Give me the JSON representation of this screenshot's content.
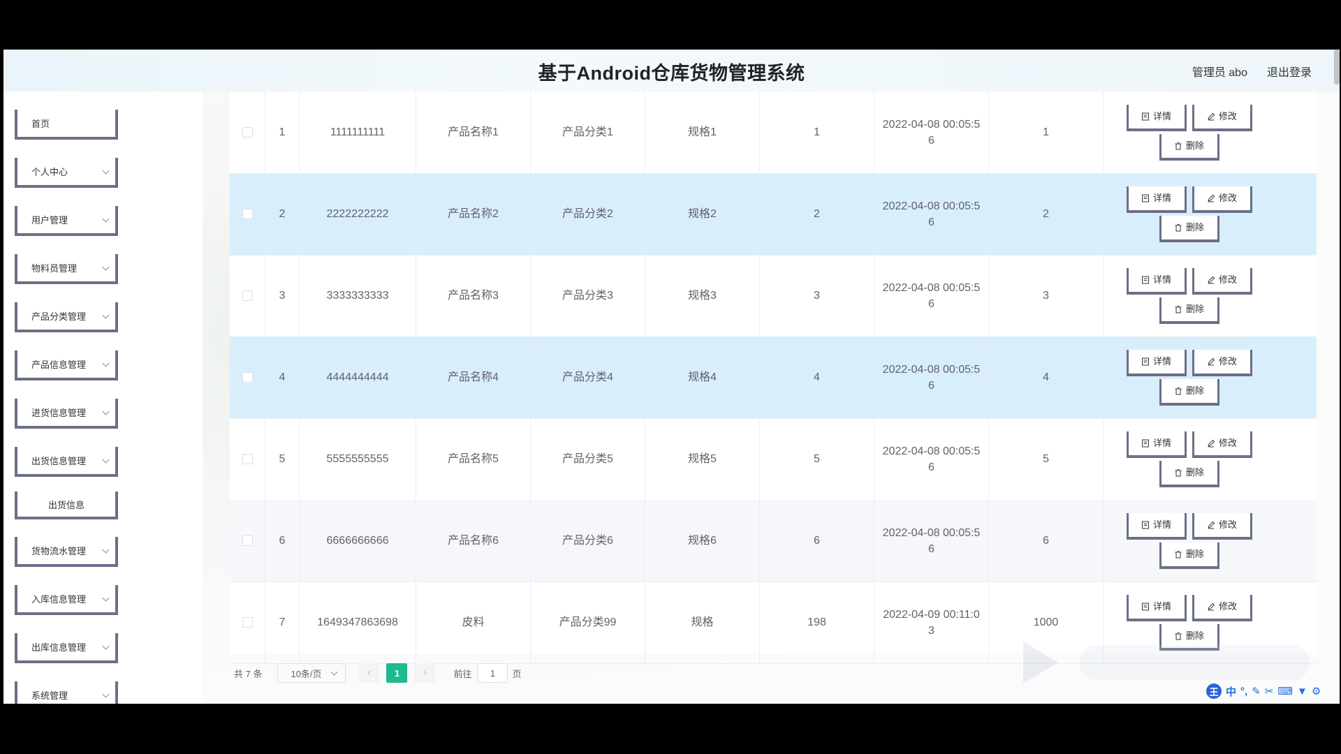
{
  "header": {
    "title": "基于Android仓库货物管理系统",
    "user": "管理员 abo",
    "logout": "退出登录"
  },
  "sidebar": {
    "items": [
      {
        "label": "首页",
        "expandable": false
      },
      {
        "label": "个人中心",
        "expandable": true
      },
      {
        "label": "用户管理",
        "expandable": true
      },
      {
        "label": "物料员管理",
        "expandable": true
      },
      {
        "label": "产品分类管理",
        "expandable": true
      },
      {
        "label": "产品信息管理",
        "expandable": true
      },
      {
        "label": "进货信息管理",
        "expandable": true
      },
      {
        "label": "出货信息管理",
        "expandable": true
      },
      {
        "label": "出货信息",
        "expandable": false,
        "sub": true
      },
      {
        "label": "货物流水管理",
        "expandable": true
      },
      {
        "label": "入库信息管理",
        "expandable": true
      },
      {
        "label": "出库信息管理",
        "expandable": true
      },
      {
        "label": "系统管理",
        "expandable": true
      }
    ]
  },
  "table": {
    "rows": [
      {
        "index": "1",
        "code": "1111111111",
        "name": "产品名称1",
        "category": "产品分类1",
        "spec": "规格1",
        "qty": "1",
        "time": "2022-04-08 00:05:56",
        "amount": "1"
      },
      {
        "index": "2",
        "code": "2222222222",
        "name": "产品名称2",
        "category": "产品分类2",
        "spec": "规格2",
        "qty": "2",
        "time": "2022-04-08 00:05:56",
        "amount": "2"
      },
      {
        "index": "3",
        "code": "3333333333",
        "name": "产品名称3",
        "category": "产品分类3",
        "spec": "规格3",
        "qty": "3",
        "time": "2022-04-08 00:05:56",
        "amount": "3"
      },
      {
        "index": "4",
        "code": "4444444444",
        "name": "产品名称4",
        "category": "产品分类4",
        "spec": "规格4",
        "qty": "4",
        "time": "2022-04-08 00:05:56",
        "amount": "4"
      },
      {
        "index": "5",
        "code": "5555555555",
        "name": "产品名称5",
        "category": "产品分类5",
        "spec": "规格5",
        "qty": "5",
        "time": "2022-04-08 00:05:56",
        "amount": "5"
      },
      {
        "index": "6",
        "code": "6666666666",
        "name": "产品名称6",
        "category": "产品分类6",
        "spec": "规格6",
        "qty": "6",
        "time": "2022-04-08 00:05:56",
        "amount": "6"
      },
      {
        "index": "7",
        "code": "1649347863698",
        "name": "皮料",
        "category": "产品分类99",
        "spec": "规格",
        "qty": "198",
        "time": "2022-04-09 00:11:03",
        "amount": "1000"
      }
    ],
    "row_styles": [
      "white",
      "blue",
      "white",
      "blue",
      "white",
      "gray",
      "white"
    ],
    "actions": {
      "detail": "详情",
      "edit": "修改",
      "delete": "删除"
    }
  },
  "pagination": {
    "total": "共 7 条",
    "page_size": "10条/页",
    "current_page": "1",
    "goto_label": "前往",
    "goto_value": "1",
    "page_suffix": "页"
  },
  "ime": {
    "logo": "王",
    "mode": "中"
  },
  "colors": {
    "accent": "#1fba8f",
    "row_highlight": "#d9eefb",
    "button_border": "#6b6f87"
  }
}
